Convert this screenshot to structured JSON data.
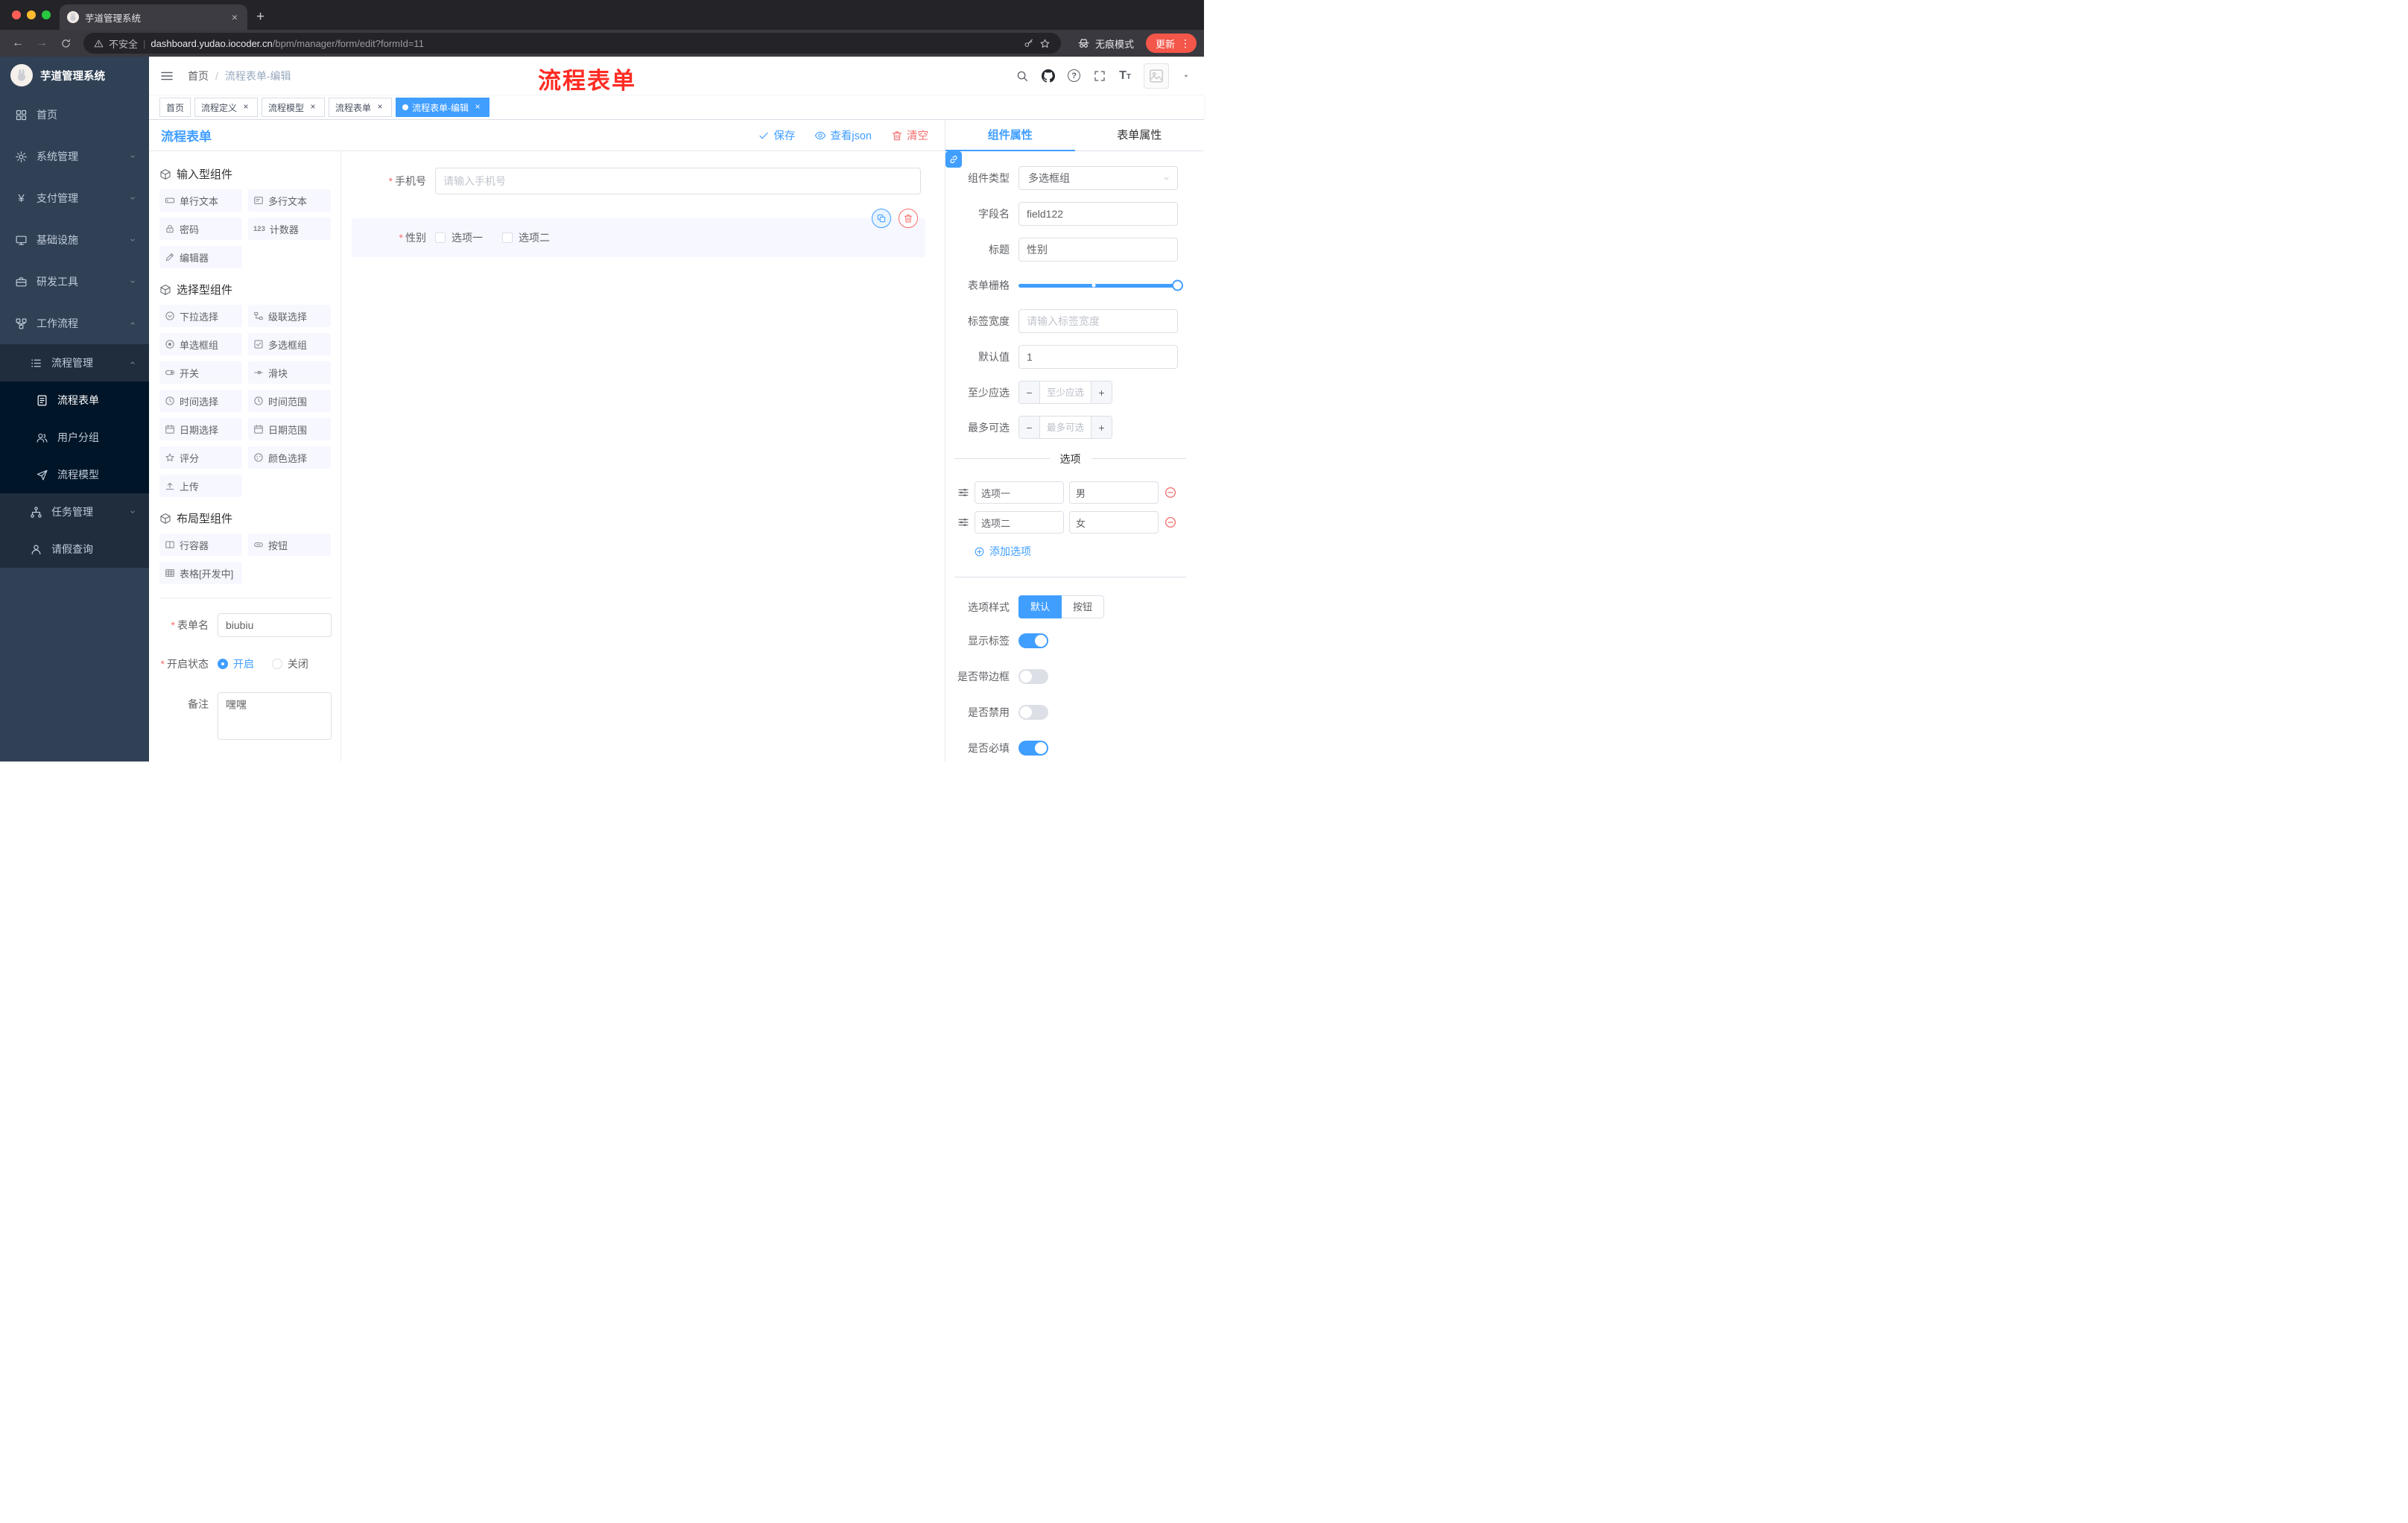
{
  "colors": {
    "accent": "#409eff",
    "danger": "#f56c6c",
    "annotation_red": "#fe2c23",
    "sidebar_bg": "#304156",
    "sidebar_sub_bg": "#1f2d3d",
    "sidebar_subsub_bg": "#001528",
    "update_pill": "#f4564a"
  },
  "icons": {
    "close": "×",
    "plus": "+",
    "minus": "−",
    "back": "←",
    "forward": "→",
    "dots": "⋮",
    "pipe": "|",
    "slash": "/",
    "asterisk": "*",
    "question": "?",
    "yen": "¥",
    "counter": "123",
    "fontsize": "T"
  },
  "browser": {
    "tab_title": "芋道管理系统",
    "security_label": "不安全",
    "url_host": "dashboard.yudao.iocoder.cn",
    "url_path": "/bpm/manager/form/edit?formId=11",
    "incognito_label": "无痕模式",
    "update_label": "更新"
  },
  "sidebar": {
    "logo_title": "芋道管理系统",
    "items": [
      {
        "label": "首页"
      },
      {
        "label": "系统管理"
      },
      {
        "label": "支付管理"
      },
      {
        "label": "基础设施"
      },
      {
        "label": "研发工具"
      },
      {
        "label": "工作流程"
      }
    ],
    "process_group": {
      "label": "流程管理",
      "children": [
        {
          "label": "流程表单"
        },
        {
          "label": "用户分组"
        },
        {
          "label": "流程模型"
        }
      ]
    },
    "task_group": {
      "label": "任务管理"
    },
    "leave_item": {
      "label": "请假查询"
    }
  },
  "header": {
    "breadcrumb": {
      "home": "首页",
      "current": "流程表单-编辑"
    },
    "annotation": "流程表单"
  },
  "tags": [
    {
      "label": "首页"
    },
    {
      "label": "流程定义"
    },
    {
      "label": "流程模型"
    },
    {
      "label": "流程表单"
    },
    {
      "label": "流程表单-编辑"
    }
  ],
  "palette": {
    "title": "流程表单",
    "group_input": {
      "title": "输入型组件",
      "items": [
        "单行文本",
        "多行文本",
        "密码",
        "计数器",
        "编辑器"
      ]
    },
    "group_select": {
      "title": "选择型组件",
      "items": [
        "下拉选择",
        "级联选择",
        "单选框组",
        "多选框组",
        "开关",
        "滑块",
        "时间选择",
        "时间范围",
        "日期选择",
        "日期范围",
        "评分",
        "颜色选择",
        "上传"
      ]
    },
    "group_layout": {
      "title": "布局型组件",
      "items": [
        "行容器",
        "按钮",
        "表格[开发中]"
      ]
    },
    "form": {
      "name_label": "表单名",
      "name_value": "biubiu",
      "status_label": "开启状态",
      "status_on": "开启",
      "status_off": "关闭",
      "remark_label": "备注",
      "remark_value": "嘿嘿"
    }
  },
  "canvas": {
    "save": "保存",
    "view_json": "查看json",
    "clear": "清空",
    "phone": {
      "label": "手机号",
      "placeholder": "请输入手机号"
    },
    "gender": {
      "label": "性别",
      "option1": "选项一",
      "option2": "选项二"
    }
  },
  "inspector": {
    "tab_component": "组件属性",
    "tab_form": "表单属性",
    "component_type": {
      "label": "组件类型",
      "value": "多选框组"
    },
    "field_name": {
      "label": "字段名",
      "value": "field122"
    },
    "title": {
      "label": "标题",
      "value": "性别"
    },
    "grid": {
      "label": "表单栅格"
    },
    "label_width": {
      "label": "标签宽度",
      "placeholder": "请输入标签宽度"
    },
    "default": {
      "label": "默认值",
      "value": "1"
    },
    "min": {
      "label": "至少应选",
      "placeholder": "至少应选"
    },
    "max": {
      "label": "最多可选",
      "placeholder": "最多可选"
    },
    "options_title": "选项",
    "options": [
      {
        "name": "选项一",
        "value": "男"
      },
      {
        "name": "选项二",
        "value": "女"
      }
    ],
    "add_option": "添加选项",
    "style": {
      "label": "选项样式",
      "default": "默认",
      "button": "按钮"
    },
    "toggle_show_label": "显示标签",
    "toggle_border": "是否带边框",
    "toggle_disabled": "是否禁用",
    "toggle_required": "是否必填"
  }
}
